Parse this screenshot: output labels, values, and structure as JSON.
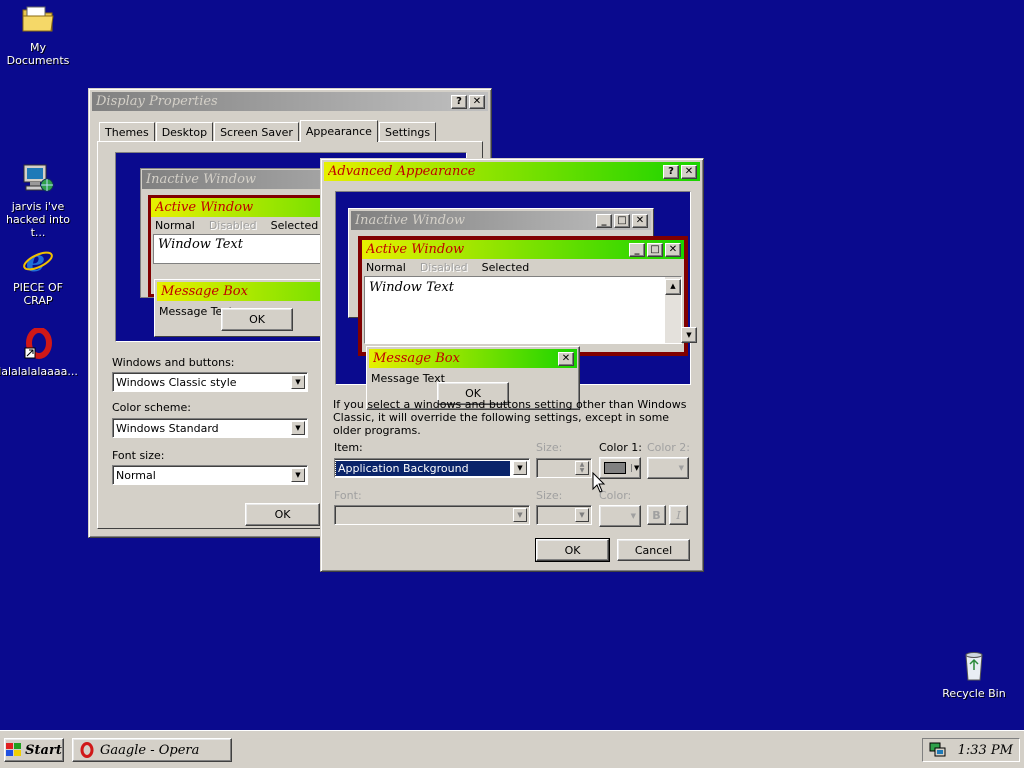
{
  "desktop": {
    "icons": [
      {
        "label": "My Documents",
        "icon": "folder-icon"
      },
      {
        "label": "jarvis i've hacked into t...",
        "icon": "network-computer-icon"
      },
      {
        "label": "PIECE OF CRAP",
        "icon": "internet-explorer-icon"
      },
      {
        "label": "lalalalalaaaa...",
        "icon": "opera-shortcut-icon"
      },
      {
        "label": "Recycle Bin",
        "icon": "recycle-bin-icon"
      }
    ]
  },
  "display_properties": {
    "title": "Display Properties",
    "tabs": [
      "Themes",
      "Desktop",
      "Screen Saver",
      "Appearance",
      "Settings"
    ],
    "active_tab": "Appearance",
    "preview": {
      "inactive_title": "Inactive Window",
      "active_title": "Active Window",
      "menu": [
        "Normal",
        "Disabled",
        "Selected"
      ],
      "window_text": "Window Text",
      "message_title": "Message Box",
      "message_text": "Message Text",
      "ok": "OK"
    },
    "windows_buttons_label": "Windows and buttons:",
    "windows_buttons_value": "Windows Classic style",
    "color_scheme_label": "Color scheme:",
    "color_scheme_value": "Windows Standard",
    "font_size_label": "Font size:",
    "font_size_value": "Normal",
    "ok": "OK"
  },
  "advanced": {
    "title": "Advanced Appearance",
    "preview": {
      "inactive_title": "Inactive Window",
      "active_title": "Active Window",
      "menu": [
        "Normal",
        "Disabled",
        "Selected"
      ],
      "window_text": "Window Text",
      "message_title": "Message Box",
      "message_text": "Message Text",
      "ok": "OK"
    },
    "info_text": "If you select a windows and buttons setting other than Windows Classic, it will override the following settings, except in some older programs.",
    "item_label": "Item:",
    "item_value": "Application Background",
    "size_label": "Size:",
    "color1_label": "Color 1:",
    "color2_label": "Color 2:",
    "font_label": "Font:",
    "size2_label": "Size:",
    "color_label": "Color:",
    "bold": "B",
    "italic": "I",
    "ok": "OK",
    "cancel": "Cancel",
    "color1_swatch": "#808080"
  },
  "taskbar": {
    "start": "Start",
    "task": "Gaagle - Opera",
    "clock": "1:33 PM"
  },
  "colors": {
    "desktop": "#0a0a8e",
    "active_title_start": "#e7f000",
    "active_title_end": "#19d400",
    "active_title_text": "#c00000",
    "active_border": "#800000",
    "selected_item": "#0a246a"
  }
}
